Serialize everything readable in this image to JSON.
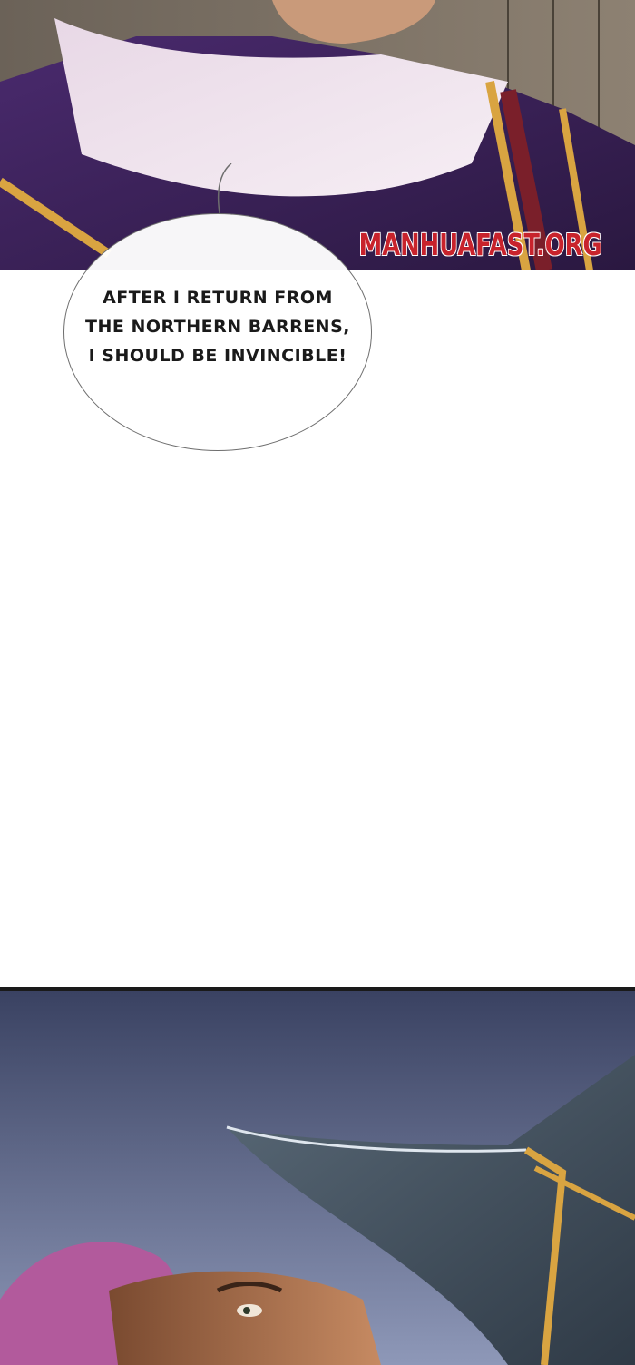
{
  "watermark": {
    "text": "MANHUAFAST.ORG",
    "color": "#c8232c"
  },
  "speech_bubble": {
    "lines": [
      "AFTER I RETURN FROM",
      "THE NORTHERN BARRENS,",
      "I SHOULD BE INVINCIBLE!"
    ]
  },
  "colors": {
    "top_panel_robe": "#3b1f5e",
    "top_panel_gold": "#d9a441",
    "bottom_panel_sky": "#4b5576",
    "boot": "#4a5a6a",
    "hair": "#b25a9c"
  }
}
